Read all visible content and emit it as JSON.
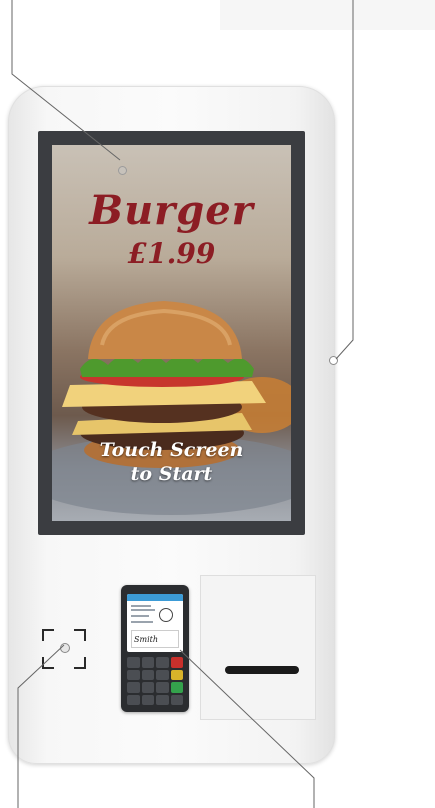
{
  "screen": {
    "headline": "Burger",
    "price": "£1.99",
    "cta_line1": "Touch Screen",
    "cta_line2": "to Start"
  },
  "terminal": {
    "signature": "Smith"
  },
  "colors": {
    "headline": "#8c1d24",
    "bezel": "#3b3d41",
    "kiosk_body": "#f7f7f7",
    "annotation_line": "#666666"
  },
  "icons": [
    "scanner-icon",
    "camera-dot-icon",
    "card-terminal-icon",
    "receipt-slot-icon",
    "side-sensor-icon"
  ]
}
